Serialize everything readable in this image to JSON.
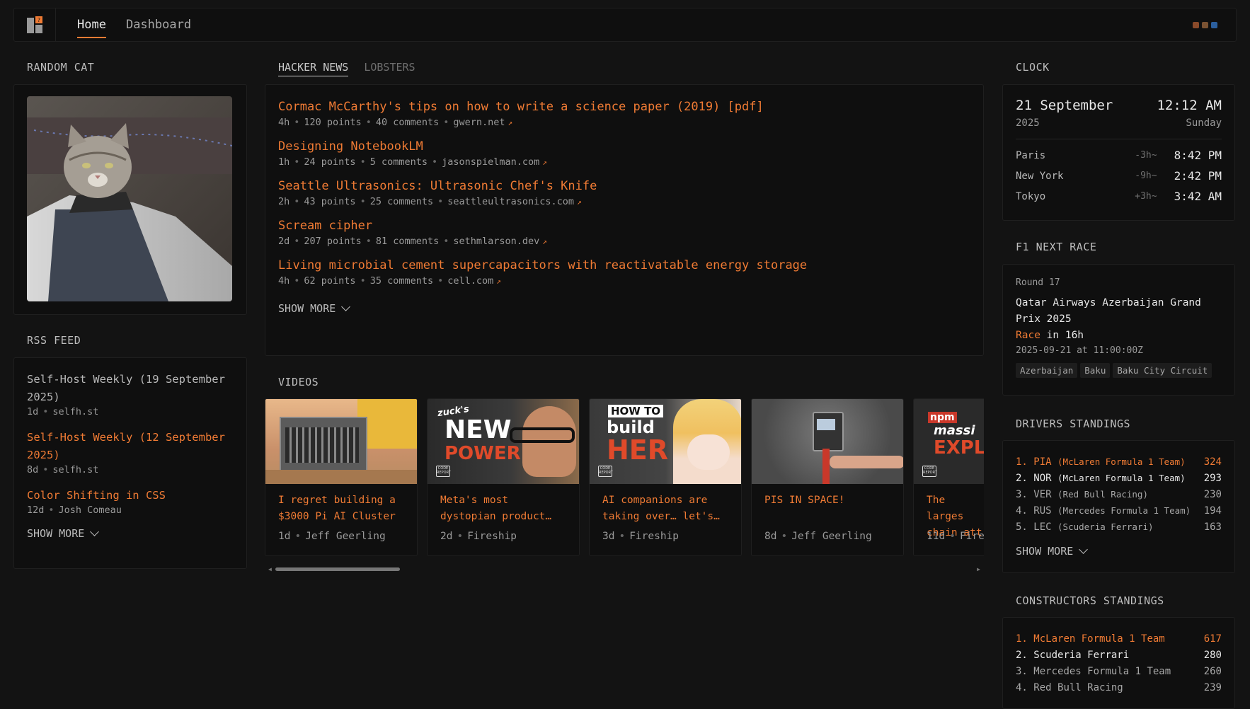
{
  "nav": {
    "items": [
      "Home",
      "Dashboard"
    ],
    "active": 0
  },
  "colors": {
    "accent": "#f07b34",
    "background": "#131313",
    "card": "#0f0f0f"
  },
  "random_cat": {
    "title": "RANDOM CAT"
  },
  "rss": {
    "title": "RSS FEED",
    "items": [
      {
        "title": "Self-Host Weekly (19 September 2025)",
        "age": "1d",
        "source": "selfh.st",
        "read": true
      },
      {
        "title": "Self-Host Weekly (12 September 2025)",
        "age": "8d",
        "source": "selfh.st",
        "read": false
      },
      {
        "title": "Color Shifting in CSS",
        "age": "12d",
        "source": "Josh Comeau",
        "read": false
      }
    ],
    "show_more": "SHOW MORE"
  },
  "news": {
    "tabs": [
      "HACKER NEWS",
      "LOBSTERS"
    ],
    "items": [
      {
        "title": "Cormac McCarthy's tips on how to write a science paper (2019) [pdf]",
        "age": "4h",
        "points": "120 points",
        "comments": "40 comments",
        "domain": "gwern.net"
      },
      {
        "title": "Designing NotebookLM",
        "age": "1h",
        "points": "24 points",
        "comments": "5 comments",
        "domain": "jasonspielman.com"
      },
      {
        "title": "Seattle Ultrasonics: Ultrasonic Chef's Knife",
        "age": "2h",
        "points": "43 points",
        "comments": "25 comments",
        "domain": "seattleultrasonics.com"
      },
      {
        "title": "Scream cipher",
        "age": "2d",
        "points": "207 points",
        "comments": "81 comments",
        "domain": "sethmlarson.dev"
      },
      {
        "title": "Living microbial cement supercapacitors with reactivatable energy storage",
        "age": "4h",
        "points": "62 points",
        "comments": "35 comments",
        "domain": "cell.com"
      }
    ],
    "show_more": "SHOW MORE"
  },
  "videos": {
    "title": "VIDEOS",
    "items": [
      {
        "title": "I regret building a $3000 Pi AI Cluster",
        "age": "1d",
        "channel": "Jeff Geerling"
      },
      {
        "title": "Meta's most dystopian product…",
        "age": "2d",
        "channel": "Fireship",
        "thumb_text_1": "zuck's",
        "thumb_text_2": "NEW",
        "thumb_text_3": "POWER"
      },
      {
        "title": "AI companions are taking over… let's…",
        "age": "3d",
        "channel": "Fireship",
        "thumb_text_1": "HOW TO",
        "thumb_text_2": "build",
        "thumb_text_3": "HER"
      },
      {
        "title": "PIS IN SPACE!",
        "age": "8d",
        "channel": "Jeff Geerling"
      },
      {
        "title": "The larges chain att",
        "age": "11d",
        "channel": "Fire",
        "thumb_text_1": "npm",
        "thumb_text_2": "massi",
        "thumb_text_3": "EXPLO"
      }
    ],
    "badge": "CODE REPORT"
  },
  "clock": {
    "title": "CLOCK",
    "date": "21 September",
    "time": "12:12 AM",
    "year": "2025",
    "weekday": "Sunday",
    "zones": [
      {
        "city": "Paris",
        "diff": "-3h~",
        "time": "8:42 PM"
      },
      {
        "city": "New York",
        "diff": "-9h~",
        "time": "2:42 PM"
      },
      {
        "city": "Tokyo",
        "diff": "+3h~",
        "time": "3:42 AM"
      }
    ]
  },
  "f1": {
    "title": "F1 NEXT RACE",
    "round": "Round 17",
    "race_name": "Qatar Airways Azerbaijan Grand Prix 2025",
    "session": "Race",
    "countdown": "in 16h",
    "datetime": "2025-09-21 at 11:00:00Z",
    "chips": [
      "Azerbaijan",
      "Baku",
      "Baku City Circuit"
    ]
  },
  "drivers": {
    "title": "DRIVERS STANDINGS",
    "rows": [
      {
        "pos": "1.",
        "code": "PIA",
        "team": "(McLaren Formula 1 Team)",
        "points": "324"
      },
      {
        "pos": "2.",
        "code": "NOR",
        "team": "(McLaren Formula 1 Team)",
        "points": "293"
      },
      {
        "pos": "3.",
        "code": "VER",
        "team": "(Red Bull Racing)",
        "points": "230"
      },
      {
        "pos": "4.",
        "code": "RUS",
        "team": "(Mercedes Formula 1 Team)",
        "points": "194"
      },
      {
        "pos": "5.",
        "code": "LEC",
        "team": "(Scuderia Ferrari)",
        "points": "163"
      }
    ],
    "show_more": "SHOW MORE"
  },
  "constructors": {
    "title": "CONSTRUCTORS STANDINGS",
    "rows": [
      {
        "pos": "1.",
        "team": "McLaren Formula 1 Team",
        "points": "617"
      },
      {
        "pos": "2.",
        "team": "Scuderia Ferrari",
        "points": "280"
      },
      {
        "pos": "3.",
        "team": "Mercedes Formula 1 Team",
        "points": "260"
      },
      {
        "pos": "4.",
        "team": "Red Bull Racing",
        "points": "239"
      }
    ]
  }
}
